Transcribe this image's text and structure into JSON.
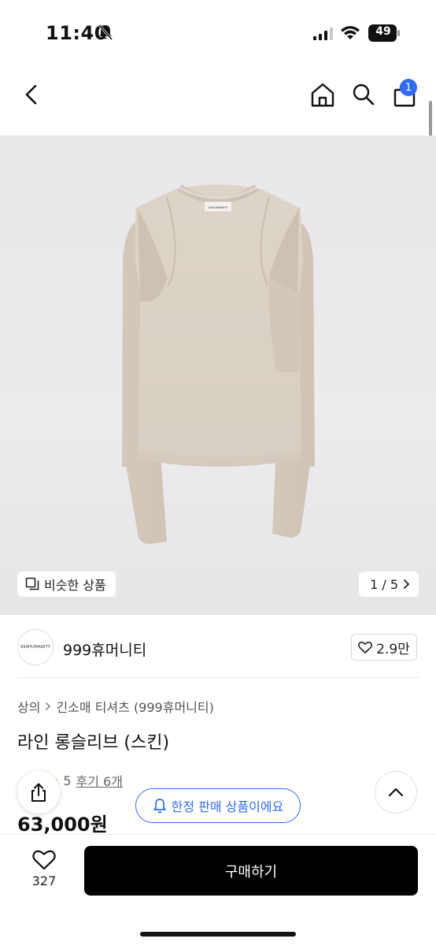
{
  "status_bar": {
    "time": "11:40",
    "battery": "49"
  },
  "nav": {
    "cart_count": "1"
  },
  "gallery": {
    "similar_label": "비슷한 상품",
    "page_indicator": "1 / 5",
    "shirt_label": "999HUMANITY"
  },
  "seller": {
    "avatar_text": "999HUMANITY",
    "name": "999휴머니티",
    "likes": "2.9만"
  },
  "product": {
    "breadcrumb_parent": "상의",
    "breadcrumb_child": "긴소매 티셔츠 (999휴머니티)",
    "title": "라인 롱슬리브 (스킨)",
    "rating_partial": "5",
    "review_link": "후기 6개",
    "price": "63,000원"
  },
  "notice": {
    "limited_label": "한정 판매 상품이에요"
  },
  "bottom_bar": {
    "wish_count": "327",
    "buy_label": "구매하기"
  },
  "colors": {
    "accent": "#2f6cf6",
    "buy_button": "#000000",
    "shirt": "#dcd3c7"
  }
}
